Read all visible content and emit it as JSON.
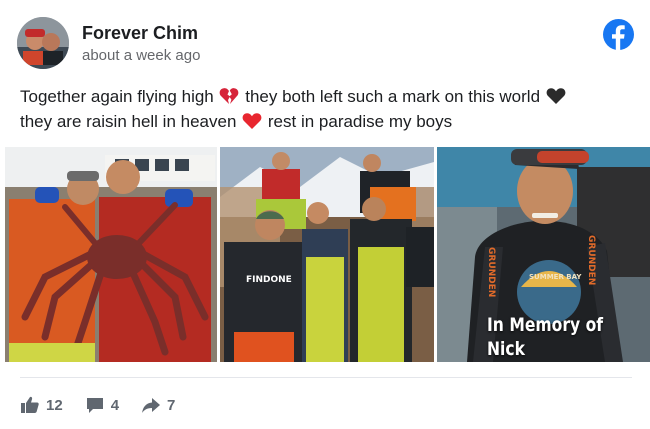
{
  "post": {
    "author": "Forever Chim",
    "timestamp": "about a week ago",
    "platform_icon": "facebook-icon",
    "text_segments": {
      "s1": "Together again flying high",
      "e1": "broken-heart-emoji",
      "s2": "they both left such a mark on this world",
      "e2": "black-heart-emoji",
      "s3": "they are raisin hell in heaven",
      "e3": "red-heart-emoji",
      "s4": "rest in paradise my boys"
    },
    "photos": [
      {
        "name": "crew-with-king-crab-photo"
      },
      {
        "name": "crew-group-on-deck-photo",
        "shirt_text": "FINDONE"
      },
      {
        "name": "memorial-photo",
        "caption_line1": "In Memory of",
        "caption_line2": "Nick McGlashan",
        "shirt_brand": "GRUNDEN",
        "shirt_print": "SUMMER BAY"
      }
    ]
  },
  "stats": {
    "likes": "12",
    "comments": "4",
    "shares": "7"
  },
  "colors": {
    "facebook_blue": "#1877f2",
    "text_primary": "#1c1e21",
    "text_secondary": "#65676b",
    "stat_gray": "#606770"
  }
}
